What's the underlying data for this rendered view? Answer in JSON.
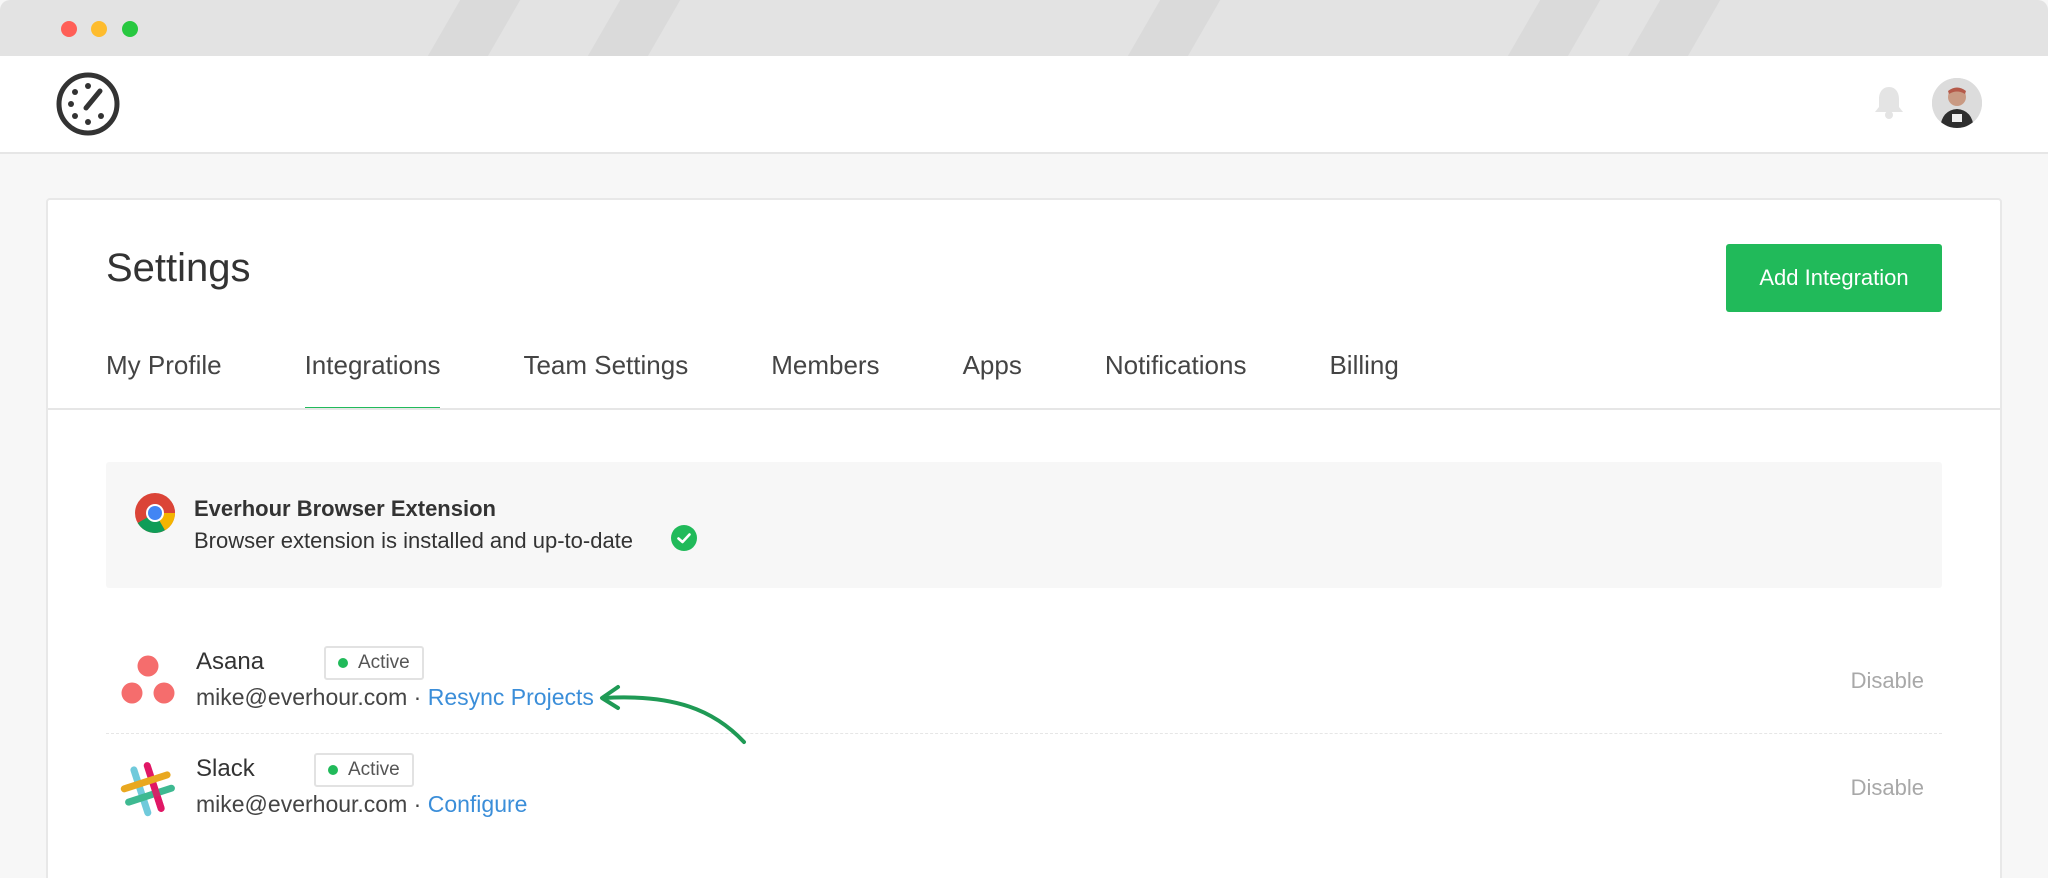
{
  "header": {
    "logo": "everhour-clock-logo",
    "bell_icon": "bell-icon",
    "avatar": "user-avatar"
  },
  "settings": {
    "title": "Settings",
    "add_button": "Add Integration"
  },
  "tabs": [
    {
      "label": "My Profile"
    },
    {
      "label": "Integrations",
      "active": true
    },
    {
      "label": "Team Settings"
    },
    {
      "label": "Members"
    },
    {
      "label": "Apps"
    },
    {
      "label": "Notifications"
    },
    {
      "label": "Billing"
    }
  ],
  "extension": {
    "title": "Everhour Browser Extension",
    "status": "Browser extension is installed and up-to-date"
  },
  "integrations": [
    {
      "name": "Asana",
      "status": "Active",
      "email": "mike@everhour.com",
      "separator": "·",
      "action": "Resync Projects",
      "disable": "Disable"
    },
    {
      "name": "Slack",
      "status": "Active",
      "email": "mike@everhour.com",
      "separator": "·",
      "action": "Configure",
      "disable": "Disable"
    }
  ],
  "colors": {
    "accent": "#21ba5a",
    "link": "#3b8ed9"
  }
}
